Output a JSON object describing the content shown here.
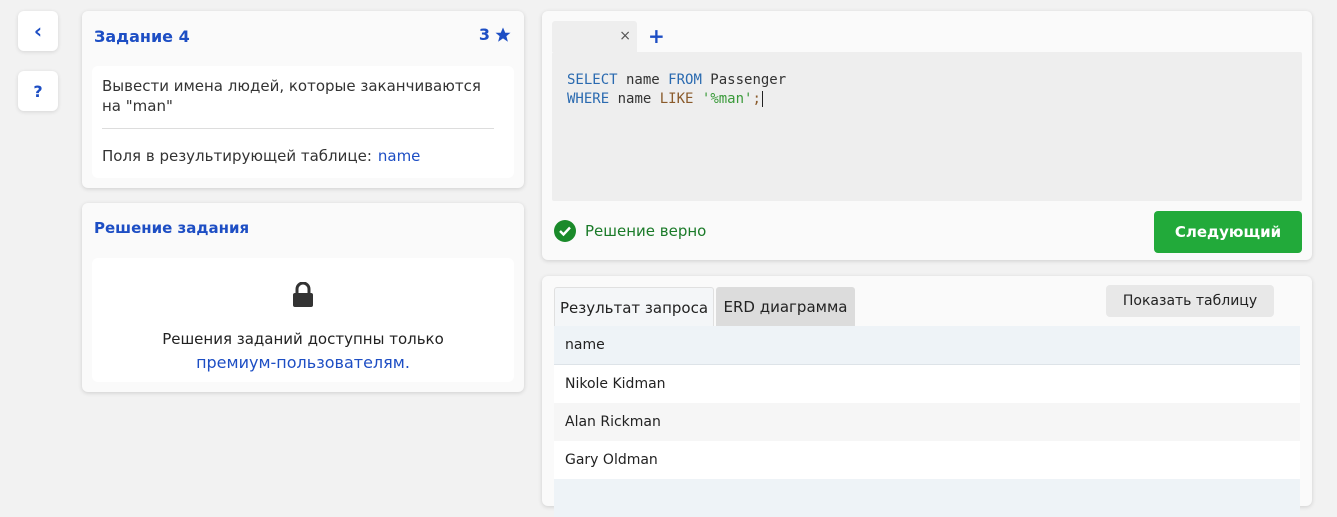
{
  "sidebar": {
    "back_glyph": "‹",
    "help_glyph": "?"
  },
  "task": {
    "title": "Задание 4",
    "difficulty": "3",
    "description": "Вывести имена людей, которые заканчиваются на \"man\"",
    "fields_label": "Поля в результирующей таблице:",
    "fields_value": "name"
  },
  "solution": {
    "title": "Решение задания",
    "locked_text": "Решения заданий доступны только",
    "locked_link": "премиум-пользователям."
  },
  "editor": {
    "tab_close": "×",
    "add_tab": "+",
    "line1": {
      "kw1": "SELECT",
      "t1": " name ",
      "kw2": "FROM",
      "t2": " Passenger"
    },
    "line2": {
      "kw1": "WHERE",
      "t1": " name ",
      "op": "LIKE",
      "t2": " ",
      "str": "'%man'",
      "end": ";"
    }
  },
  "result": {
    "status": "Решение верно",
    "next_button": "Следующий"
  },
  "results_panel": {
    "tabs": [
      "Результат запроса",
      "ERD диаграмма"
    ],
    "active_tab": "Результат запроса",
    "show_table_button": "Показать таблицу",
    "columns": [
      "name"
    ],
    "rows": [
      [
        "Nikole Kidman"
      ],
      [
        "Alan Rickman"
      ],
      [
        "Gary Oldman"
      ]
    ]
  },
  "colors": {
    "accent": "#1d4ec4",
    "success": "#22aa3a",
    "background": "#f2f2f2"
  },
  "icons": [
    "chevron-left-icon",
    "help-icon",
    "star-icon",
    "lock-icon",
    "check-circle-icon",
    "close-icon",
    "plus-icon"
  ]
}
